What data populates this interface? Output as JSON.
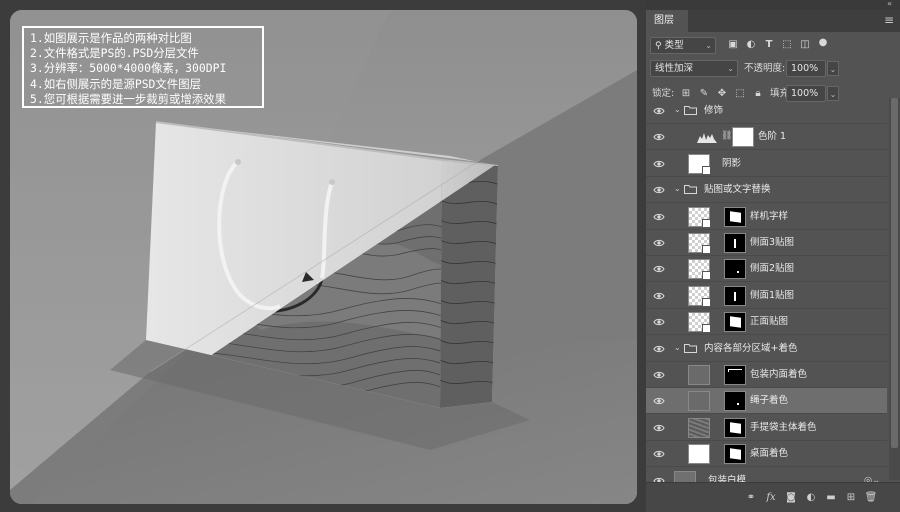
{
  "canvas": {
    "notes": [
      "1.如图展示是作品的两种对比图",
      "2.文件格式是PS的.PSD分层文件",
      "3.分辨率：5000*4000像素，300DPI",
      "4.如右侧展示的是源PSD文件图层",
      "5.您可根据需要进一步裁剪或增添效果"
    ],
    "colors": {
      "background": "#9a9a9a",
      "bag_white": "#dcdcdc",
      "bag_print": "#6f6f6f"
    }
  },
  "panel": {
    "tab_label": "图层",
    "collapse_glyph": "«",
    "menu_icon": "hamburger-icon",
    "filter": {
      "value": "类型",
      "search_icon": "search-icon"
    },
    "filter_icons": [
      "pixel-filter-icon",
      "adjustment-filter-icon",
      "type-filter-icon",
      "shape-filter-icon",
      "smart-object-filter-icon",
      "filter-toggle-icon"
    ],
    "blend_mode": "线性加深",
    "opacity_label": "不透明度:",
    "opacity_value": "100%",
    "lock_label": "锁定:",
    "lock_icons": [
      "lock-transparent-icon",
      "lock-pixels-icon",
      "lock-position-icon",
      "lock-artboard-icon",
      "lock-all-icon"
    ],
    "fill_label": "填充:",
    "fill_value": "100%",
    "layers": [
      {
        "name": "修饰",
        "kind": "group",
        "indent": 0,
        "visible": true
      },
      {
        "name": "色阶 1",
        "kind": "adjustment",
        "indent": 1,
        "visible": true
      },
      {
        "name": "阴影",
        "kind": "smart-white",
        "indent": 1,
        "visible": true
      },
      {
        "name": "贴图或文字替换",
        "kind": "group",
        "indent": 0,
        "visible": true
      },
      {
        "name": "样机字样",
        "kind": "smart-checker-mask",
        "mask": "white-block",
        "indent": 1,
        "visible": true
      },
      {
        "name": "侧面3贴图",
        "kind": "smart-checker-mask",
        "mask": "thin-bar",
        "indent": 1,
        "visible": true
      },
      {
        "name": "侧面2贴图",
        "kind": "smart-checker-mask",
        "mask": "dot",
        "indent": 1,
        "visible": true
      },
      {
        "name": "侧面1贴图",
        "kind": "smart-checker-mask",
        "mask": "thin-bar",
        "indent": 1,
        "visible": true
      },
      {
        "name": "正面贴图",
        "kind": "smart-checker-mask",
        "mask": "white-block",
        "indent": 1,
        "visible": true
      },
      {
        "name": "内容各部分区域+着色",
        "kind": "group",
        "indent": 0,
        "visible": true
      },
      {
        "name": "包装内面着色",
        "kind": "gray-mask",
        "mask": "edge-dots",
        "indent": 1,
        "visible": true
      },
      {
        "name": "绳子着色",
        "kind": "gray-mask",
        "mask": "dot",
        "indent": 1,
        "visible": true,
        "selected": true
      },
      {
        "name": "手提袋主体着色",
        "kind": "texture-mask",
        "mask": "white-block",
        "indent": 1,
        "visible": true
      },
      {
        "name": "桌面着色",
        "kind": "white-mask",
        "mask": "white-block",
        "indent": 1,
        "visible": true
      },
      {
        "name": "包装白模",
        "kind": "smart-gray",
        "indent": 0,
        "visible": true,
        "badge": "smart-object-badge-icon"
      }
    ],
    "footer_icons": [
      "link-layers-icon",
      "fx-icon",
      "add-mask-icon",
      "adjustment-layer-icon",
      "new-group-icon",
      "new-layer-icon",
      "delete-icon"
    ],
    "footer_labels": {
      "fx": "fx"
    }
  }
}
